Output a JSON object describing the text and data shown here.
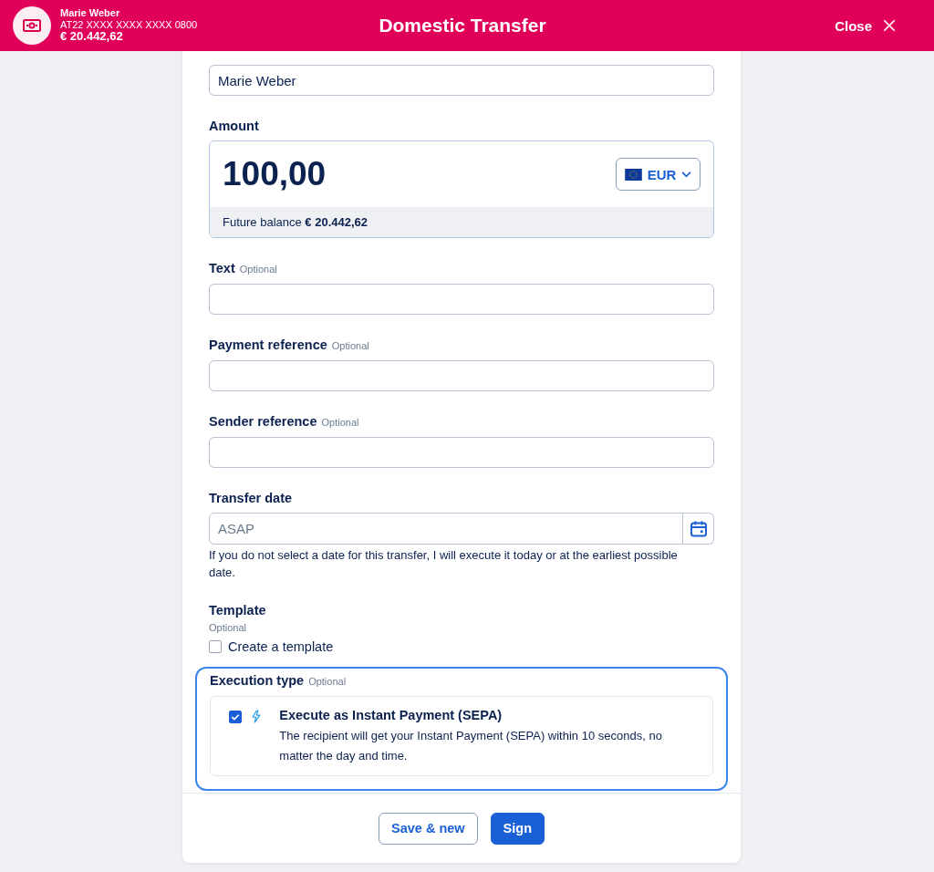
{
  "header": {
    "account_name": "Marie Weber",
    "iban": "AT22 XXXX XXXX XXXX 0800",
    "balance": "€ 20.442,62",
    "title": "Domestic Transfer",
    "close": "Close"
  },
  "sender_name": {
    "value": "Marie Weber"
  },
  "amount": {
    "label": "Amount",
    "value": "100,00",
    "currency": "EUR",
    "future_balance": "Future balance **€ 20.442,62**"
  },
  "fields": [
    {
      "label": "Text",
      "optional": "Optional"
    },
    {
      "label": "Payment reference",
      "optional": "Optional"
    },
    {
      "label": "Sender reference",
      "optional": "Optional"
    }
  ],
  "transfer_date": {
    "label": "Transfer date",
    "placeholder": "ASAP",
    "help": "If you do not select a date for this transfer, I will execute it today or at the earliest possible date."
  },
  "template": {
    "label": "Template",
    "optional": "Optional",
    "checkbox": {
      "label": "Create a template",
      "checked": false
    }
  },
  "execution_type": {
    "label": "Execution type",
    "optional": "Optional",
    "focused": true,
    "option": {
      "title": "Execute as Instant Payment (SEPA)",
      "description": "The recipient will get your Instant Payment (SEPA) within 10 seconds, no matter the day and time.",
      "checked": true
    }
  },
  "buttons": [
    {
      "label": "Save & new",
      "kind": "secondary"
    },
    {
      "label": "Sign",
      "kind": "primary"
    }
  ]
}
